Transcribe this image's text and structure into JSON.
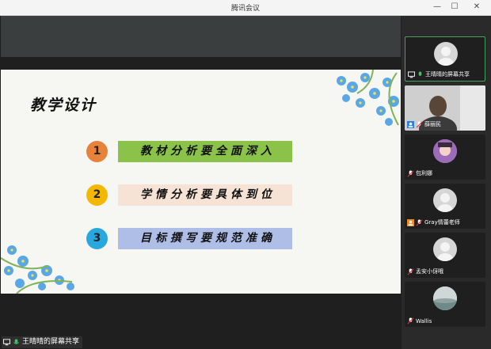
{
  "window": {
    "title": "腾讯会议"
  },
  "slide": {
    "title": "教学设计",
    "items": [
      {
        "number": "1",
        "text": "教材分析要全面深入",
        "circle_color": "#e8823a",
        "bar_color": "#8bc34a"
      },
      {
        "number": "2",
        "text": "学情分析要具体到位",
        "circle_color": "#f5b800",
        "bar_color": "#f6e3d6"
      },
      {
        "number": "3",
        "text": "目标撰写要规范准确",
        "circle_color": "#29a8e0",
        "bar_color": "#aebee6"
      }
    ]
  },
  "screen_share": {
    "label": "王晴晴的屏幕共享"
  },
  "participants": [
    {
      "name": "王晴晴的屏幕共享",
      "video": "avatar",
      "badge": "screen-share-icon"
    },
    {
      "name": "薛丽民",
      "video": "camera",
      "badge": "user-icon"
    },
    {
      "name": "包利娜",
      "video": "anime-avatar",
      "badge": ""
    },
    {
      "name": "Gray情蕾老师",
      "video": "avatar",
      "badge": "user-icon"
    },
    {
      "name": "孟安小伢哦",
      "video": "avatar",
      "badge": ""
    },
    {
      "name": "Wallis",
      "video": "landscape",
      "badge": ""
    }
  ]
}
